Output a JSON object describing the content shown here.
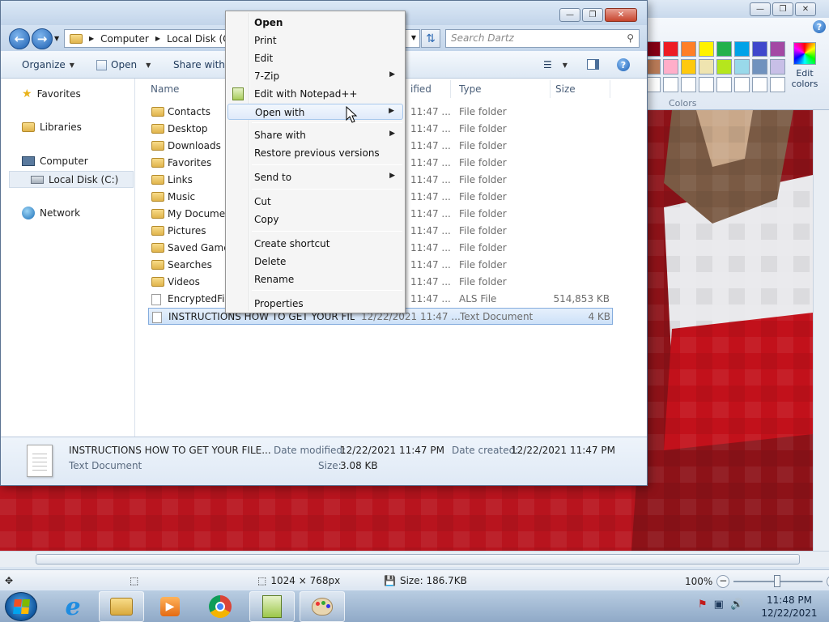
{
  "explorer": {
    "breadcrumb": [
      "Computer",
      "Local Disk (C:)"
    ],
    "search_placeholder": "Search Dartz",
    "toolbar": {
      "organize": "Organize",
      "open": "Open",
      "share_with": "Share with"
    },
    "nav": {
      "favorites": "Favorites",
      "libraries": "Libraries",
      "computer": "Computer",
      "local_disk": "Local Disk (C:)",
      "network": "Network"
    },
    "columns": {
      "name": "Name",
      "date": "ified",
      "type": "Type",
      "size": "Size"
    },
    "files": [
      {
        "name": "Contacts",
        "date": "11:47 ...",
        "type": "File folder",
        "size": ""
      },
      {
        "name": "Desktop",
        "date": "11:47 ...",
        "type": "File folder",
        "size": ""
      },
      {
        "name": "Downloads",
        "date": "11:47 ...",
        "type": "File folder",
        "size": ""
      },
      {
        "name": "Favorites",
        "date": "11:47 ...",
        "type": "File folder",
        "size": ""
      },
      {
        "name": "Links",
        "date": "11:47 ...",
        "type": "File folder",
        "size": ""
      },
      {
        "name": "Music",
        "date": "11:47 ...",
        "type": "File folder",
        "size": ""
      },
      {
        "name": "My Documen",
        "date": "11:47 ...",
        "type": "File folder",
        "size": ""
      },
      {
        "name": "Pictures",
        "date": "11:47 ...",
        "type": "File folder",
        "size": ""
      },
      {
        "name": "Saved Games",
        "date": "11:47 ...",
        "type": "File folder",
        "size": ""
      },
      {
        "name": "Searches",
        "date": "11:47 ...",
        "type": "File folder",
        "size": ""
      },
      {
        "name": "Videos",
        "date": "11:47 ...",
        "type": "File folder",
        "size": ""
      },
      {
        "name": "EncryptedFile",
        "date": "11:47 ...",
        "type": "ALS File",
        "size": "514,853 KB"
      },
      {
        "name": "INSTRUCTIONS HOW TO GET YOUR FILE...",
        "date": "12/22/2021 11:47 ...",
        "type": "Text Document",
        "size": "4 KB"
      }
    ],
    "details": {
      "filename": "INSTRUCTIONS HOW TO GET YOUR FILE...",
      "filetype": "Text Document",
      "modified_label": "Date modified:",
      "modified_value": "12/22/2021 11:47 PM",
      "created_label": "Date created:",
      "created_value": "12/22/2021 11:47 PM",
      "size_label": "Size:",
      "size_value": "3.08 KB"
    }
  },
  "context_menu": {
    "items": [
      {
        "label": "Open",
        "bold": true,
        "submenu": false
      },
      {
        "label": "Print",
        "submenu": false
      },
      {
        "label": "Edit",
        "submenu": false
      },
      {
        "label": "7-Zip",
        "submenu": true
      },
      {
        "label": "Edit with Notepad++",
        "submenu": false,
        "icon": "notepadpp-icon"
      },
      {
        "label": "Open with",
        "submenu": true,
        "highlighted": true
      },
      {
        "label": "Share with",
        "submenu": true
      },
      {
        "label": "Restore previous versions",
        "submenu": false
      },
      {
        "label": "Send to",
        "submenu": true
      },
      {
        "label": "Cut",
        "submenu": false
      },
      {
        "label": "Copy",
        "submenu": false
      },
      {
        "label": "Create shortcut",
        "submenu": false
      },
      {
        "label": "Delete",
        "submenu": false
      },
      {
        "label": "Rename",
        "submenu": false
      },
      {
        "label": "Properties",
        "submenu": false
      }
    ]
  },
  "paint": {
    "colors_label": "Colors",
    "edit_colors": "Edit colors",
    "palette": [
      "#880015",
      "#ed1c24",
      "#ff7f27",
      "#fff200",
      "#22b14c",
      "#00a2e8",
      "#3f48cc",
      "#a349a4",
      "#b97a57",
      "#ffaec9",
      "#ffc90e",
      "#efe4b0",
      "#b5e61d",
      "#99d9ea",
      "#7092be",
      "#c8bfe7",
      "#ffffff",
      "#ffffff",
      "#ffffff",
      "#ffffff",
      "#ffffff",
      "#ffffff",
      "#ffffff",
      "#ffffff"
    ],
    "status": {
      "dimensions": "1024 × 768px",
      "size": "Size: 186.7KB",
      "zoom": "100%"
    }
  },
  "taskbar": {
    "time": "11:48 PM",
    "date": "12/22/2021"
  }
}
